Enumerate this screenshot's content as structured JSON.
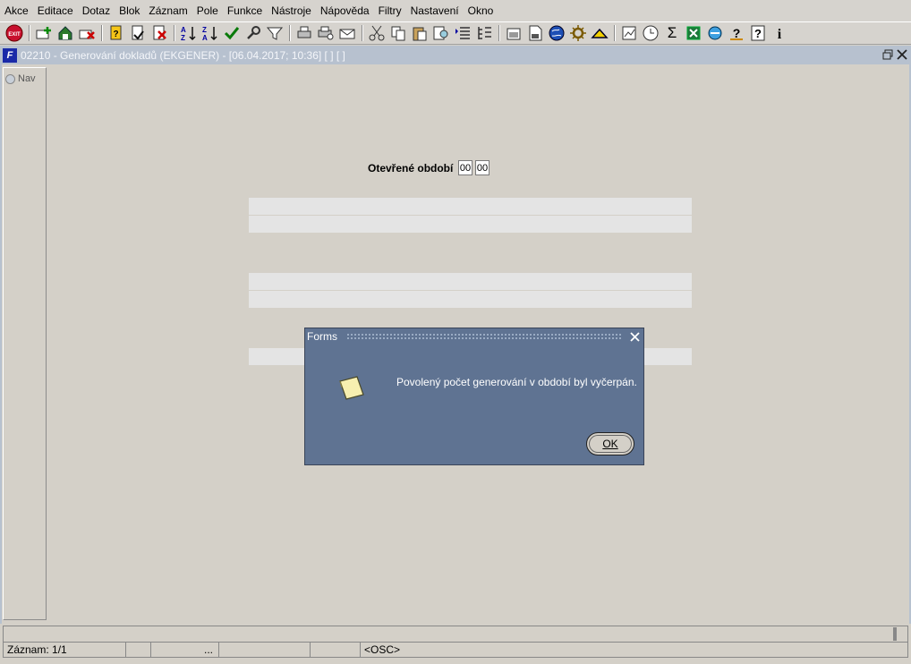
{
  "menu": [
    "Akce",
    "Editace",
    "Dotaz",
    "Blok",
    "Záznam",
    "Pole",
    "Funkce",
    "Nástroje",
    "Nápověda",
    "Filtry",
    "Nastavení",
    "Okno"
  ],
  "toolbar": {
    "icons": [
      "exit-icon",
      "insert-record-icon",
      "save-icon",
      "delete-record-icon",
      "query-enter-icon",
      "query-execute-icon",
      "query-cancel-icon",
      "sort-asc-icon",
      "sort-desc-icon",
      "check-icon",
      "wrench-icon",
      "filter-icon",
      "print-icon",
      "print-preview-icon",
      "mail-icon",
      "cut-icon",
      "copy-icon",
      "paste-icon",
      "search-icon",
      "list-icon",
      "tree-icon",
      "attach-icon",
      "document-icon",
      "globe-icon",
      "settings-wheel-icon",
      "triangle-icon",
      "chart-icon",
      "clock-icon",
      "sum-icon",
      "excel-icon",
      "ie-icon",
      "wizard-icon",
      "help-icon",
      "info-icon"
    ],
    "exit_label": "EXIT"
  },
  "window": {
    "title": "02210 - Generování dokladů (EKGENER) - [06.04.2017; 10:36]  [ ]  [ ]",
    "app_icon": "F"
  },
  "nav": {
    "label": "Nav"
  },
  "form": {
    "period_label": "Otevřené období",
    "period_month": "00",
    "period_year": "00"
  },
  "dialog": {
    "title": "Forms",
    "message": "Povolený počet generování v období byl vyčerpán.",
    "ok_label": "OK"
  },
  "status": {
    "record": "Záznam: 1/1",
    "ellipsis": "...",
    "mode": "<OSC>"
  }
}
